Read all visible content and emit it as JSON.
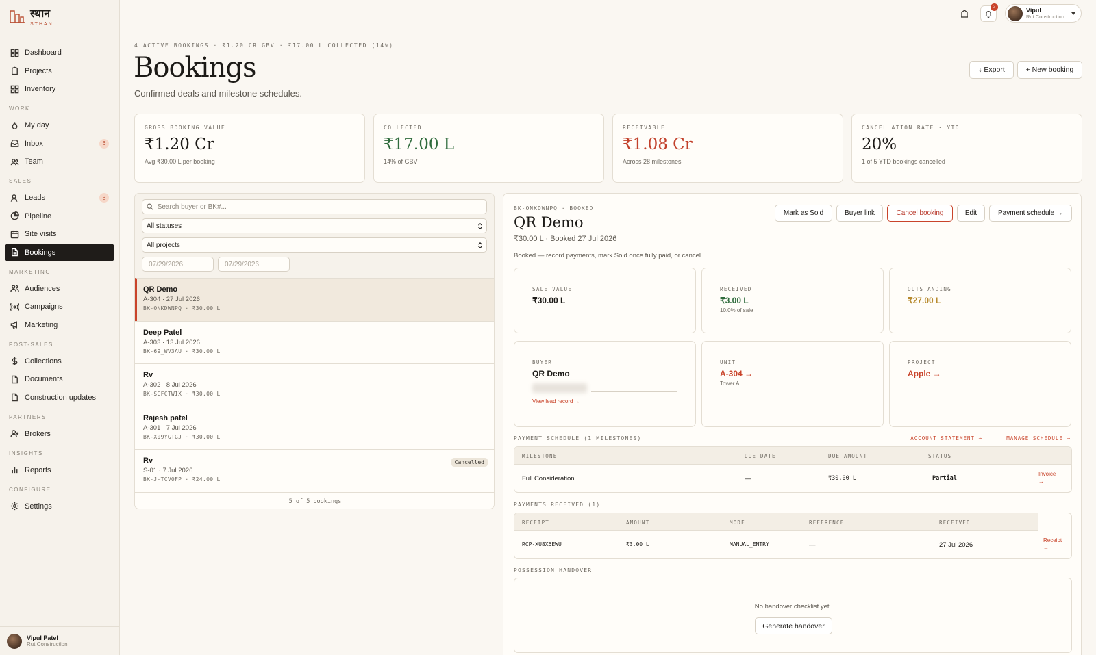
{
  "brand": {
    "name": "स्थान",
    "sub": "STHAN"
  },
  "nav": {
    "top": [
      {
        "label": "Dashboard",
        "icon": "dashboard-icon"
      },
      {
        "label": "Projects",
        "icon": "projects-icon"
      },
      {
        "label": "Inventory",
        "icon": "inventory-icon"
      }
    ],
    "work_label": "WORK",
    "work": [
      {
        "label": "My day",
        "icon": "flame-icon"
      },
      {
        "label": "Inbox",
        "icon": "inbox-icon",
        "badge": "6"
      },
      {
        "label": "Team",
        "icon": "team-icon"
      }
    ],
    "sales_label": "SALES",
    "sales": [
      {
        "label": "Leads",
        "icon": "user-icon",
        "badge": "8"
      },
      {
        "label": "Pipeline",
        "icon": "pipeline-icon"
      },
      {
        "label": "Site visits",
        "icon": "calendar-icon"
      },
      {
        "label": "Bookings",
        "icon": "document-icon",
        "active": true
      }
    ],
    "marketing_label": "MARKETING",
    "marketing": [
      {
        "label": "Audiences",
        "icon": "users-icon"
      },
      {
        "label": "Campaigns",
        "icon": "campaign-icon"
      },
      {
        "label": "Marketing",
        "icon": "megaphone-icon"
      }
    ],
    "postsales_label": "POST-SALES",
    "postsales": [
      {
        "label": "Collections",
        "icon": "dollar-icon"
      },
      {
        "label": "Documents",
        "icon": "document-icon"
      },
      {
        "label": "Construction updates",
        "icon": "document-icon"
      }
    ],
    "partners_label": "PARTNERS",
    "partners": [
      {
        "label": "Brokers",
        "icon": "user-plus-icon"
      }
    ],
    "insights_label": "INSIGHTS",
    "insights": [
      {
        "label": "Reports",
        "icon": "bar-chart-icon"
      }
    ],
    "configure_label": "CONFIGURE",
    "configure": [
      {
        "label": "Settings",
        "icon": "gear-icon"
      }
    ]
  },
  "sidebar_user": {
    "name": "Vipul Patel",
    "org": "Rut Construction"
  },
  "topbar": {
    "notif_count": "2",
    "user_name": "Vipul",
    "user_org": "Rut Construction"
  },
  "header": {
    "kicker": "4 ACTIVE BOOKINGS · ₹1.20 CR GBV · ₹17.00 L COLLECTED (14%)",
    "title": "Bookings",
    "subtitle": "Confirmed deals and milestone schedules.",
    "export_label": "↓ Export",
    "new_label": "+ New booking"
  },
  "stats": [
    {
      "label": "GROSS BOOKING VALUE",
      "value": "₹1.20 Cr",
      "sub": "Avg ₹30.00 L per booking",
      "color": "#1c1a17"
    },
    {
      "label": "COLLECTED",
      "value": "₹17.00 L",
      "sub": "14% of GBV",
      "color": "#2f6b3c"
    },
    {
      "label": "RECEIVABLE",
      "value": "₹1.08 Cr",
      "sub": "Across 28 milestones",
      "color": "#c2402b"
    },
    {
      "label": "CANCELLATION RATE · YTD",
      "value": "20%",
      "sub": "1 of 5 YTD bookings cancelled",
      "color": "#1c1a17"
    }
  ],
  "filters": {
    "search_placeholder": "Search buyer or BK#...",
    "status": "All statuses",
    "project": "All projects",
    "date_from": "07/29/2026",
    "date_to": "07/29/2026"
  },
  "bookings": [
    {
      "name": "QR Demo",
      "sub": "A-304 · 27 Jul 2026",
      "code": "BK-ONKDWNPQ · ₹30.00 L",
      "badge": ""
    },
    {
      "name": "Deep Patel",
      "sub": "A-303 · 13 Jul 2026",
      "code": "BK-69_WV3AU · ₹30.00 L",
      "badge": ""
    },
    {
      "name": "Rv",
      "sub": "A-302 · 8 Jul 2026",
      "code": "BK-SGFCTWIX · ₹30.00 L",
      "badge": ""
    },
    {
      "name": "Rajesh patel",
      "sub": "A-301 · 7 Jul 2026",
      "code": "BK-X09YGTGJ · ₹30.00 L",
      "badge": ""
    },
    {
      "name": "Rv",
      "sub": "S-01 · 7 Jul 2026",
      "code": "BK-J-TCV0FP · ₹24.00 L",
      "badge": "Cancelled"
    }
  ],
  "list_footer": "5 of 5 bookings",
  "detail": {
    "code": "BK-ONKDWNPQ  ·  BOOKED",
    "title": "QR Demo",
    "sub": "₹30.00 L · Booked 27 Jul 2026",
    "note": "Booked — record payments, mark Sold once fully paid, or cancel.",
    "buttons": {
      "sold": "Mark as Sold",
      "buyer": "Buyer link",
      "cancel": "Cancel booking",
      "edit": "Edit",
      "schedule": "Payment schedule →"
    },
    "sale": {
      "label": "SALE VALUE",
      "value": "₹30.00 L"
    },
    "received": {
      "label": "RECEIVED",
      "value": "₹3.00 L",
      "sub": "10.0% of sale"
    },
    "outstanding": {
      "label": "OUTSTANDING",
      "value": "₹27.00 L"
    },
    "buyer": {
      "label": "BUYER",
      "value": "QR Demo",
      "link": "View lead record →"
    },
    "unit": {
      "label": "UNIT",
      "value": "A-304 →",
      "sub": "Tower A"
    },
    "project": {
      "label": "PROJECT",
      "value": "Apple →"
    },
    "schedule": {
      "label": "PAYMENT SCHEDULE (1 MILESTONES)",
      "statement": "ACCOUNT STATEMENT →",
      "manage": "MANAGE SCHEDULE →",
      "headers": [
        "MILESTONE",
        "DUE DATE",
        "DUE AMOUNT",
        "STATUS"
      ],
      "row": {
        "milestone": "Full Consideration",
        "due": "—",
        "amount": "₹30.00 L",
        "status": "Partial",
        "action": "Invoice →"
      }
    },
    "payments": {
      "label": "PAYMENTS RECEIVED (1)",
      "headers": [
        "RECEIPT",
        "AMOUNT",
        "MODE",
        "REFERENCE",
        "RECEIVED"
      ],
      "row": {
        "receipt": "RCP-XU8X6EWU",
        "amount": "₹3.00 L",
        "mode": "MANUAL_ENTRY",
        "ref": "—",
        "received": "27 Jul 2026",
        "action": "Receipt →"
      }
    },
    "handover": {
      "label": "POSSESSION HANDOVER",
      "empty": "No handover checklist yet.",
      "button": "Generate handover"
    }
  },
  "colors": {
    "accent": "#c9442b",
    "dark": "#1f1c19",
    "green": "#2f6b3c",
    "amber": "#b78a2e"
  }
}
